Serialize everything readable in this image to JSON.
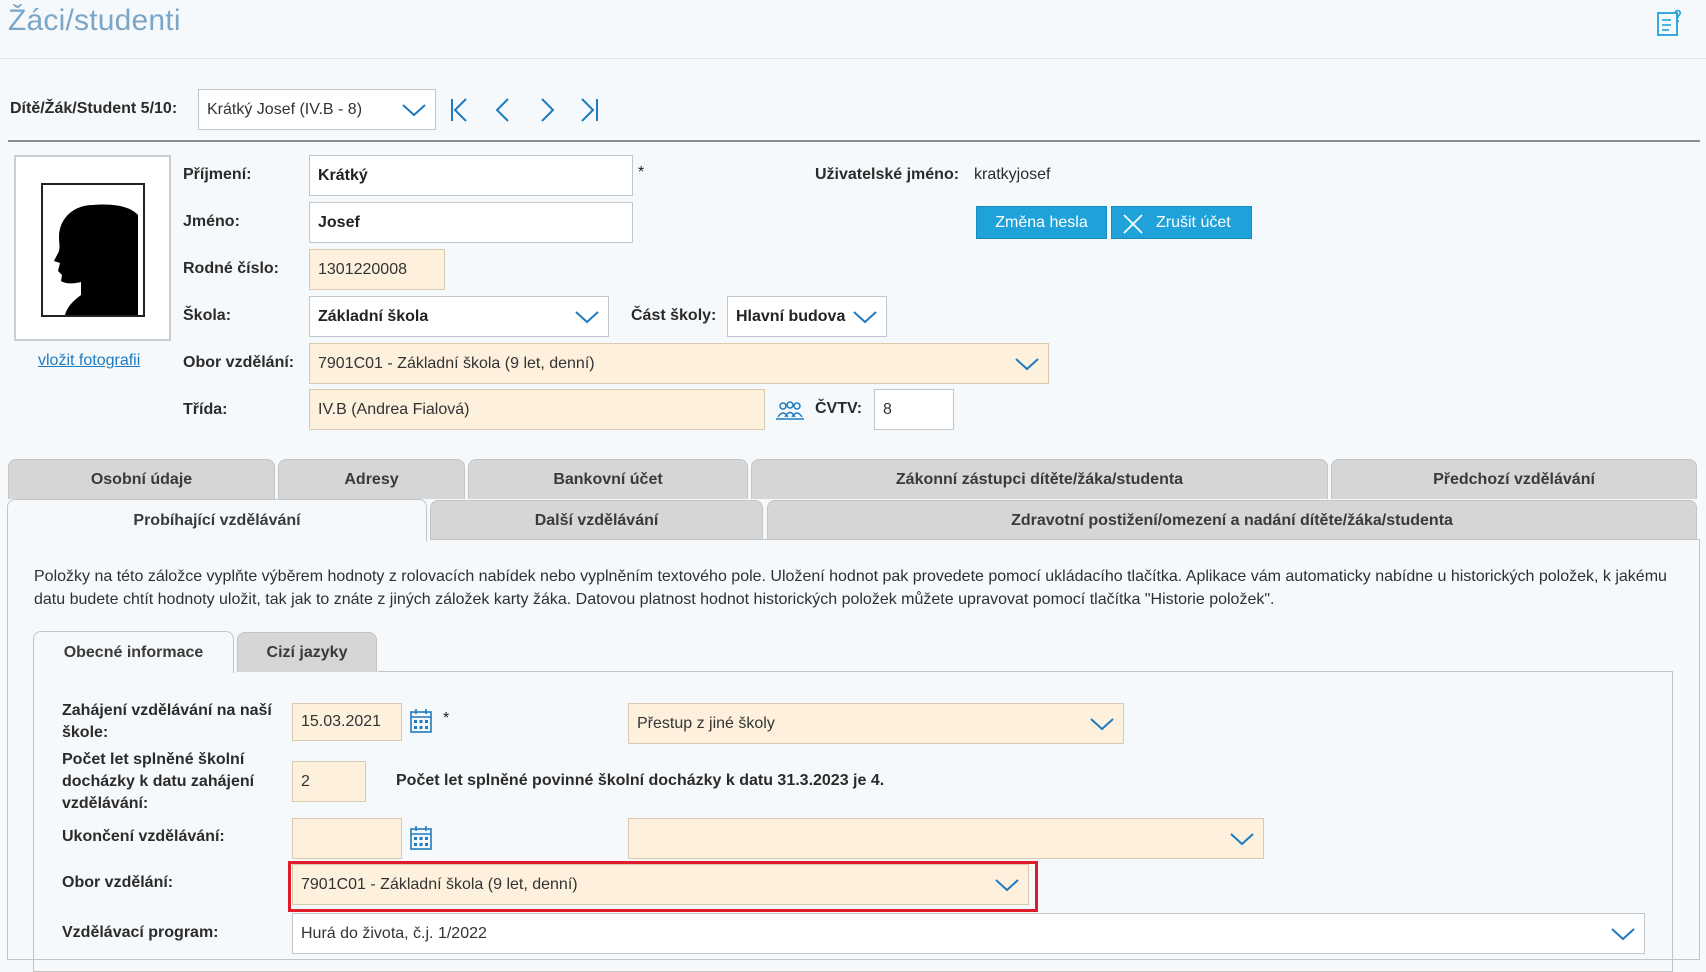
{
  "header": {
    "title": "Žáci/studenti",
    "help_icon": "help-document-icon"
  },
  "nav": {
    "label": "Dítě/Žák/Student 5/10:",
    "selected_student": "Krátký Josef (IV.B - 8)"
  },
  "photo": {
    "link": "vložit fotografii"
  },
  "form": {
    "surname_label": "Příjmení:",
    "surname": "Krátký",
    "required_mark": "*",
    "firstname_label": "Jméno:",
    "firstname": "Josef",
    "birth_number_label": "Rodné číslo:",
    "birth_number": "1301220008",
    "school_label": "Škola:",
    "school": "Základní škola",
    "school_part_label": "Část školy:",
    "school_part": "Hlavní budova",
    "field_label": "Obor vzdělání:",
    "field": "7901C01 - Základní škola (9 let, denní)",
    "class_label": "Třída:",
    "class": "IV.B (Andrea Fialová)",
    "cvtv_label": "ČVTV:",
    "cvtv": "8",
    "username_label": "Uživatelské jméno:",
    "username": "kratkyjosef",
    "change_password": "Změna hesla",
    "cancel_account": "Zrušit účet"
  },
  "tabs_row1": [
    "Osobní údaje",
    "Adresy",
    "Bankovní účet",
    "Zákonní zástupci dítěte/žáka/studenta",
    "Předchozí vzdělávání"
  ],
  "tabs_row2": [
    "Probíhající vzdělávání",
    "Další vzdělávání",
    "Zdravotní postižení/omezení a nadání dítěte/žáka/studenta"
  ],
  "info_text": "Položky na této záložce vyplňte výběrem hodnoty z rolovacích nabídek nebo vyplněním textového pole. Uložení hodnot pak provedete pomocí ukládacího tlačítka. Aplikace vám automaticky nabídne u historických položek, k jakému datu budete chtít hodnoty uložit, tak jak to znáte z jiných záložek karty žáka. Datovou platnost hodnot historických položek můžete upravovat pomocí tlačítka \"Historie položek\".",
  "subtabs": [
    "Obecné informace",
    "Cizí jazyky"
  ],
  "edu": {
    "start_label": "Zahájení vzdělávání na naší škole:",
    "start_date": "15.03.2021",
    "start_required": "*",
    "start_reason": "Přestup z jiné školy",
    "years_label": "Počet let splněné školní docházky k datu zahájení vzdělávání:",
    "years": "2",
    "years_note": "Počet let splněné povinné školní docházky k datu 31.3.2023 je 4.",
    "end_label": "Ukončení vzdělávání:",
    "end_date": "",
    "end_reason": "",
    "field_label": "Obor vzdělání:",
    "field": "7901C01 - Základní škola (9 let, denní)",
    "program_label": "Vzdělávací program:",
    "program": "Hurá do života, č.j. 1/2022"
  },
  "colors": {
    "title": "#7ba6c7",
    "accent_blue": "#1fa2da",
    "peach_field": "#fdf1dd",
    "highlight_red": "#e01b2a"
  }
}
